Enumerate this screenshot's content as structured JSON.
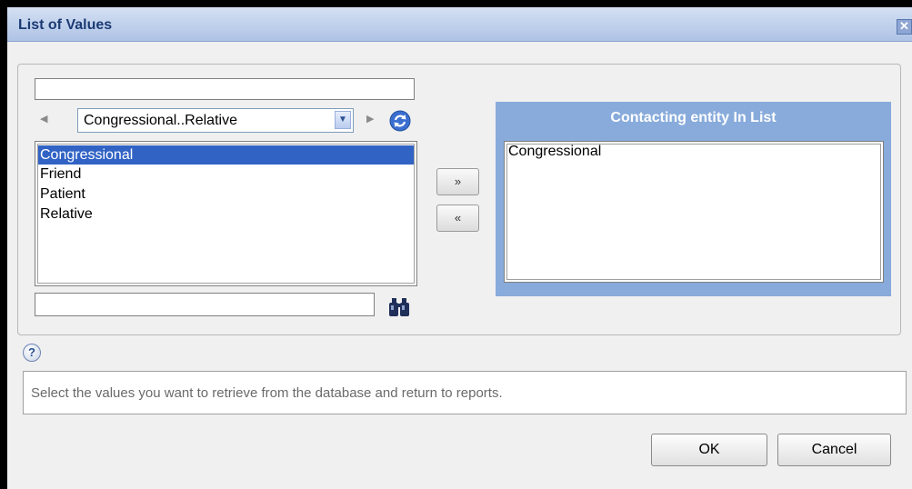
{
  "dialog": {
    "title": "List of Values",
    "close_icon": "close-icon"
  },
  "left_panel": {
    "filter_value": "",
    "range_select": {
      "value": "Congressional..Relative"
    },
    "values": [
      {
        "label": "Congressional",
        "selected": true
      },
      {
        "label": "Friend",
        "selected": false
      },
      {
        "label": "Patient",
        "selected": false
      },
      {
        "label": "Relative",
        "selected": false
      }
    ],
    "search_value": "",
    "icons": {
      "prev": "triangle-left-icon",
      "next": "triangle-right-icon",
      "refresh": "refresh-icon",
      "search": "binoculars-icon"
    }
  },
  "transfer": {
    "add_label": "»",
    "remove_label": "«"
  },
  "right_panel": {
    "header": "Contacting entity In List",
    "values": [
      "Congressional"
    ]
  },
  "help": {
    "icon": "help-icon",
    "text": "Select the values you want to retrieve from the database and return to reports."
  },
  "buttons": {
    "ok": "OK",
    "cancel": "Cancel"
  },
  "colors": {
    "title_bar": "#aec3e5",
    "selection": "#3163c5",
    "right_panel": "#88abdb"
  }
}
